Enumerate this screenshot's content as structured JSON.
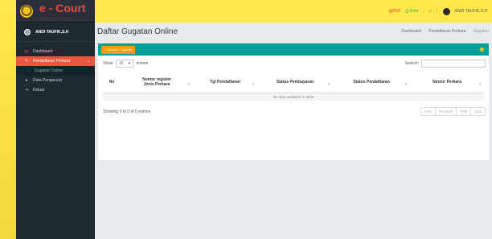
{
  "brand": {
    "title": "e - Court",
    "subtitle": "The Electronic Justice System"
  },
  "user": {
    "name": "ANDI TAUFIK,S.H"
  },
  "topbar": {
    "pdf": "PDF",
    "print": "Print",
    "user_label": "ANDI TAUFIK,S.H"
  },
  "sidebar": {
    "items": [
      {
        "label": "Dashboard",
        "icon": "monitor-icon"
      },
      {
        "label": "Pendaftaran Perkara",
        "icon": "edit-icon"
      },
      {
        "label": "Gugatan Online",
        "icon": "arrow-icon"
      },
      {
        "label": "Data Pengacara",
        "icon": "user-icon"
      },
      {
        "label": "Keluar",
        "icon": "logout-icon"
      }
    ]
  },
  "page": {
    "title": "Daftar Gugatan Online"
  },
  "breadcrumb": [
    "Dashboard",
    "Pendaftaran Perkara",
    "Gugatan"
  ],
  "box": {
    "add_button": "+ Tambah Gugatan"
  },
  "datatable": {
    "show_label": "Show",
    "length_value": "10",
    "entries_label": "entries",
    "search_label": "Search:",
    "columns": [
      "No",
      "Nomor register\nJenis Perkara",
      "Tgl Pendaftaran",
      "Status Pembayaran",
      "Status Pendaftaran",
      "Nomor Perkara"
    ],
    "empty_message": "No data available in table",
    "info": "Showing 0 to 0 of 0 entries",
    "pager": [
      "First",
      "Previous",
      "Next",
      "Last"
    ]
  },
  "colors": {
    "teal": "#00a09a",
    "orange": "#f39c12",
    "active_menu": "#e9573f",
    "sidebar": "#1f2a30"
  }
}
